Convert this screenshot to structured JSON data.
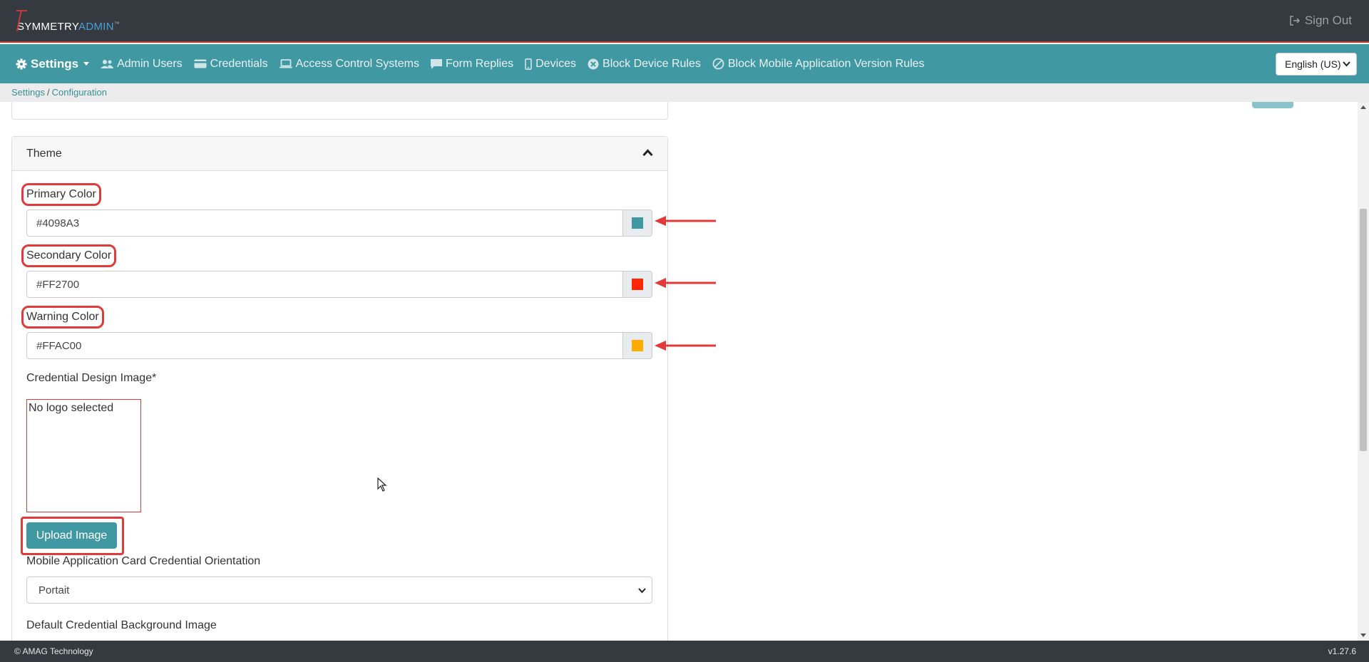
{
  "header": {
    "logo_primary": "SYMMETRY",
    "logo_secondary": "ADMIN",
    "signout_label": "Sign Out"
  },
  "nav": {
    "items": [
      {
        "label": "Settings",
        "icon": "gear-icon",
        "active": true
      },
      {
        "label": "Admin Users",
        "icon": "users-icon"
      },
      {
        "label": "Credentials",
        "icon": "credential-card-icon"
      },
      {
        "label": "Access Control Systems",
        "icon": "laptop-icon"
      },
      {
        "label": "Form Replies",
        "icon": "comment-icon"
      },
      {
        "label": "Devices",
        "icon": "mobile-icon"
      },
      {
        "label": "Block Device Rules",
        "icon": "circle-x-icon"
      },
      {
        "label": "Block Mobile Application Version Rules",
        "icon": "ban-icon"
      }
    ],
    "language": "English (US)"
  },
  "breadcrumb": {
    "items": [
      "Settings",
      "Configuration"
    ]
  },
  "theme": {
    "title": "Theme",
    "primary_color": {
      "label": "Primary Color",
      "value": "#4098A3",
      "swatch": "#4098a3"
    },
    "secondary_color": {
      "label": "Secondary Color",
      "value": "#FF2700",
      "swatch": "#ff2700"
    },
    "warning_color": {
      "label": "Warning Color",
      "value": "#FFAC00",
      "swatch": "#ffac00"
    },
    "credential_image_label": "Credential Design Image*",
    "no_logo_text": "No logo selected",
    "upload_label": "Upload Image",
    "orientation_label": "Mobile Application Card Credential Orientation",
    "orientation_value": "Portait",
    "background_label": "Default Credential Background Image"
  },
  "footer": {
    "copyright": "© AMAG Technology",
    "version": "v1.27.6"
  },
  "colors": {
    "primary": "#4098a3",
    "header_bg": "#343a40",
    "annotation_red": "#e03a3a"
  }
}
